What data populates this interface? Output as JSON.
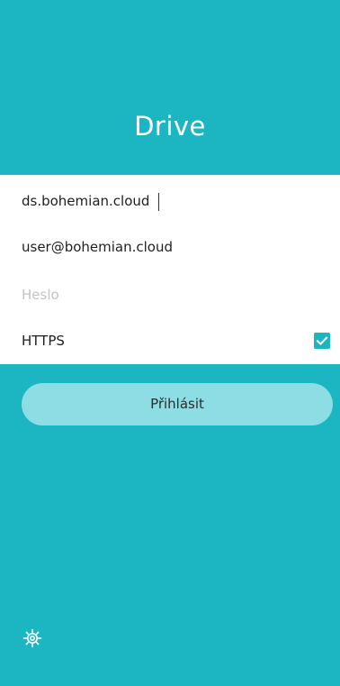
{
  "header": {
    "title": "Drive"
  },
  "form": {
    "server": {
      "value": "ds.bohemian.cloud"
    },
    "username": {
      "value": "user@bohemian.cloud"
    },
    "password": {
      "placeholder": "Heslo",
      "value": ""
    },
    "https": {
      "label": "HTTPS",
      "checked": true
    }
  },
  "actions": {
    "login_label": "Přihlásit"
  },
  "footer": {
    "settings_icon": "gear-icon"
  },
  "colors": {
    "brand": "#1cb5c2",
    "button": "#8cdde4",
    "form_background": "#ffffff"
  }
}
